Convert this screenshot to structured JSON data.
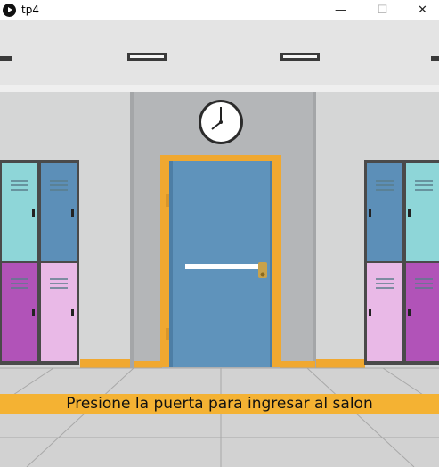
{
  "window": {
    "title": "tp4",
    "controls": {
      "minimize": "—",
      "maximize": "☐",
      "close": "✕"
    }
  },
  "scene": {
    "prompt": "Presione la puerta para ingresar al salon",
    "colors": {
      "door": "#5f93bb",
      "door_frame": "#f0a830",
      "wall_left_right": "#d5d6d6",
      "wall_center": "#b4b6b8",
      "ceiling": "#e4e4e4",
      "floor": "#d2d2d2",
      "locker_cyan": "#8ed6d8",
      "locker_blue": "#5c8fb8",
      "locker_magenta": "#b153b8",
      "locker_pink": "#e9b9e7",
      "prompt_band": "#f4b233"
    },
    "icons": {
      "wall_clock": "clock-icon",
      "app": "play-circle-icon"
    }
  }
}
